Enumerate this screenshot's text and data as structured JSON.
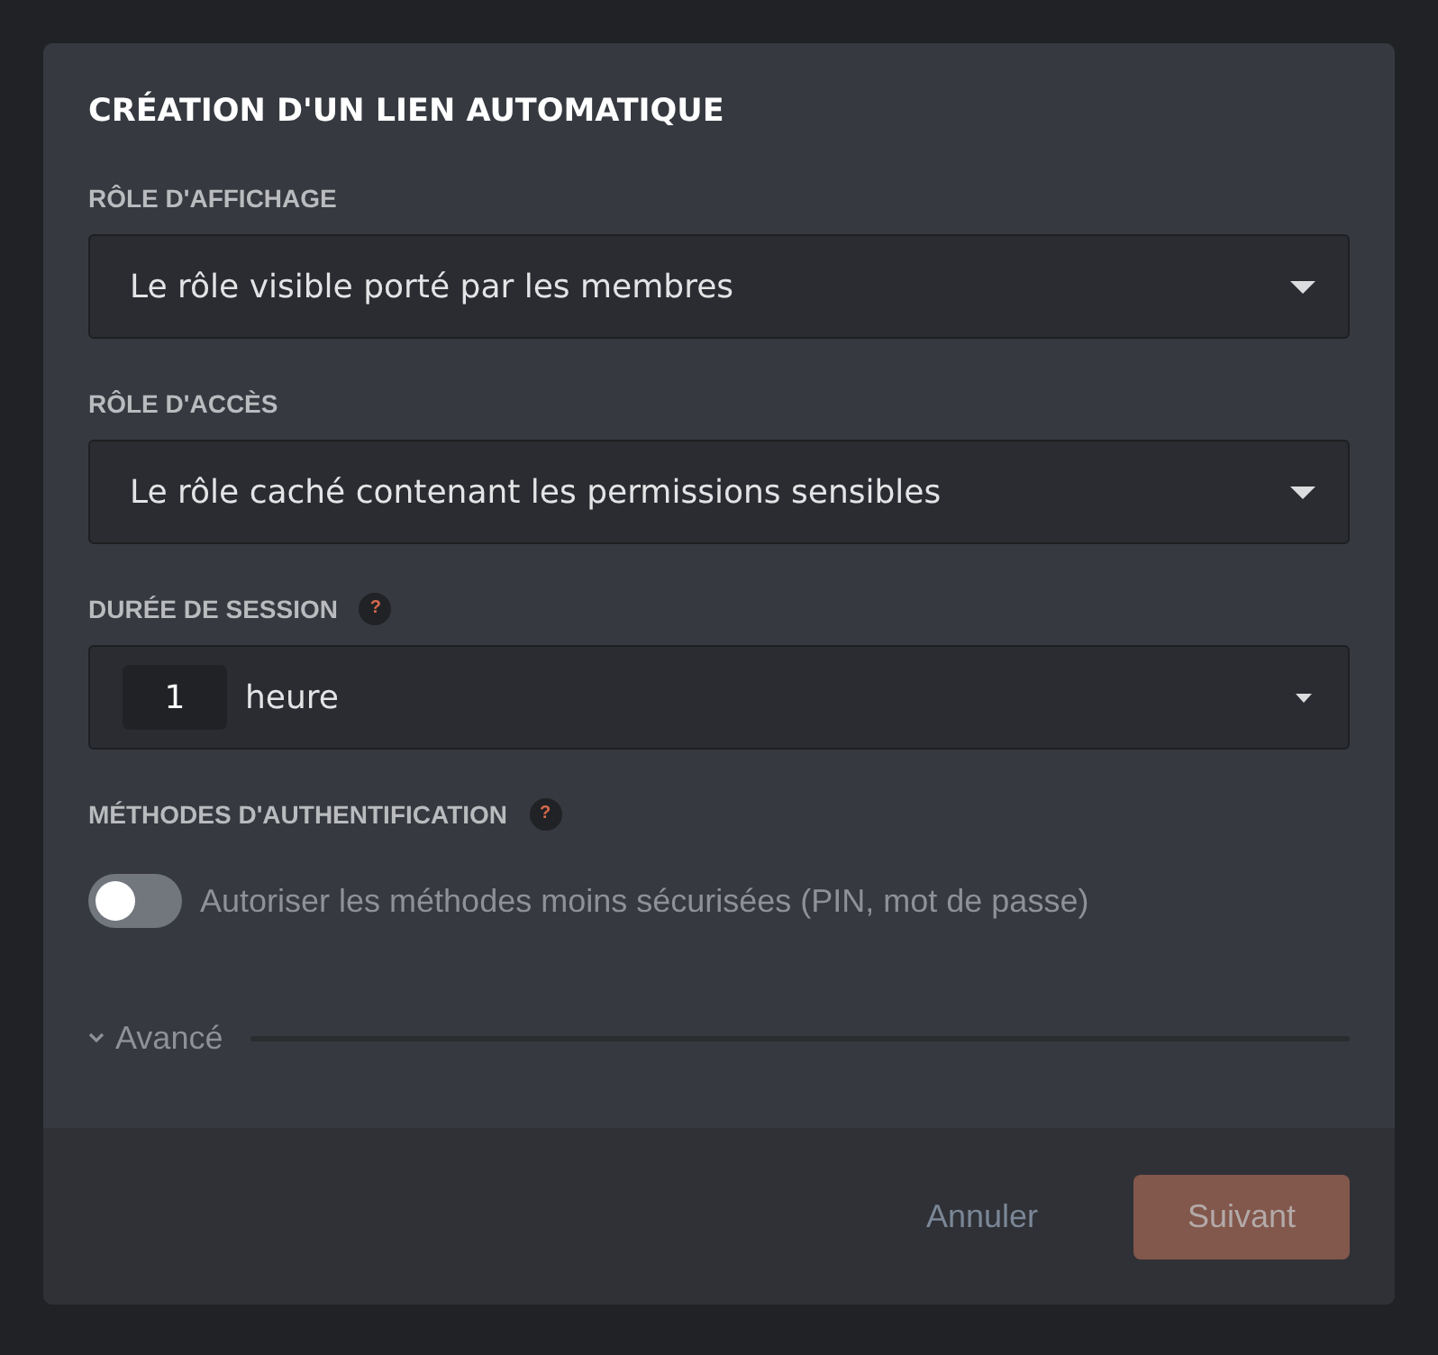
{
  "dialog": {
    "title": "CRÉATION D'UN LIEN AUTOMATIQUE",
    "fields": [
      {
        "kind": "select",
        "label": "RÔLE D'AFFICHAGE",
        "value": "Le rôle visible porté par les membres"
      },
      {
        "kind": "select",
        "label": "RÔLE D'ACCÈS",
        "value": "Le rôle caché contenant les permissions sensibles"
      },
      {
        "kind": "duration",
        "label": "DURÉE DE SESSION",
        "help": "?",
        "amount": "1",
        "unit": "heure"
      },
      {
        "kind": "toggle",
        "label": "MÉTHODES D'AUTHENTIFICATION",
        "help": "?",
        "toggle_label": "Autoriser les méthodes moins sécurisées (PIN, mot de passe)",
        "on": false
      }
    ],
    "advanced": {
      "label": "Avancé"
    },
    "footer": {
      "buttons": [
        {
          "kind": "link",
          "label": "Annuler",
          "disabled": false
        },
        {
          "kind": "primary",
          "label": "Suivant",
          "disabled": true
        }
      ]
    }
  }
}
